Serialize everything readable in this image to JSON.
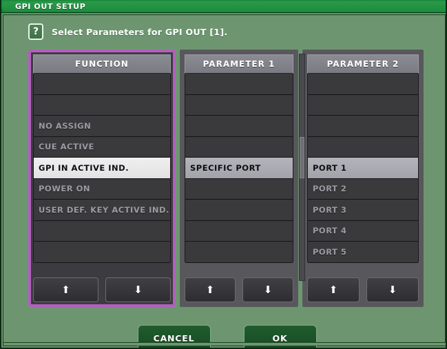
{
  "window": {
    "title": "GPI OUT SETUP"
  },
  "help": {
    "icon": "question-mark-icon",
    "glyph": "?",
    "message": "Select Parameters for GPI OUT [1]."
  },
  "columns": [
    {
      "id": "function",
      "header": "FUNCTION",
      "focused": true,
      "rows": [
        {
          "label": "",
          "state": "empty"
        },
        {
          "label": "",
          "state": "empty"
        },
        {
          "label": "NO ASSIGN",
          "state": "normal"
        },
        {
          "label": "CUE ACTIVE",
          "state": "normal"
        },
        {
          "label": "GPI IN ACTIVE IND.",
          "state": "selected-bright"
        },
        {
          "label": "POWER ON",
          "state": "normal"
        },
        {
          "label": "USER DEF. KEY ACTIVE IND.",
          "state": "normal"
        },
        {
          "label": "",
          "state": "empty"
        },
        {
          "label": "",
          "state": "empty"
        }
      ],
      "scroll_up": {
        "icon": "arrow-up-icon",
        "glyph": "⬆"
      },
      "scroll_down": {
        "icon": "arrow-down-icon",
        "glyph": "⬇"
      }
    },
    {
      "id": "parameter-1",
      "header": "PARAMETER 1",
      "focused": false,
      "rows": [
        {
          "label": "",
          "state": "empty"
        },
        {
          "label": "",
          "state": "empty"
        },
        {
          "label": "",
          "state": "empty"
        },
        {
          "label": "",
          "state": "empty"
        },
        {
          "label": "SPECIFIC PORT",
          "state": "selected-mid"
        },
        {
          "label": "",
          "state": "empty"
        },
        {
          "label": "",
          "state": "empty"
        },
        {
          "label": "",
          "state": "empty"
        },
        {
          "label": "",
          "state": "empty"
        }
      ],
      "scroll_up": {
        "icon": "arrow-up-icon",
        "glyph": "⬆"
      },
      "scroll_down": {
        "icon": "arrow-down-icon",
        "glyph": "⬇"
      }
    },
    {
      "id": "parameter-2",
      "header": "PARAMETER 2",
      "focused": false,
      "rows": [
        {
          "label": "",
          "state": "empty"
        },
        {
          "label": "",
          "state": "empty"
        },
        {
          "label": "",
          "state": "empty"
        },
        {
          "label": "",
          "state": "empty"
        },
        {
          "label": "PORT 1",
          "state": "selected-mid"
        },
        {
          "label": "PORT 2",
          "state": "normal"
        },
        {
          "label": "PORT 3",
          "state": "normal"
        },
        {
          "label": "PORT 4",
          "state": "normal"
        },
        {
          "label": "PORT 5",
          "state": "normal"
        }
      ],
      "scroll_up": {
        "icon": "arrow-up-icon",
        "glyph": "⬆"
      },
      "scroll_down": {
        "icon": "arrow-down-icon",
        "glyph": "⬇"
      }
    }
  ],
  "actions": {
    "cancel_label": "CANCEL",
    "ok_label": "OK"
  },
  "colors": {
    "background": "#6d9670",
    "titlebar": "#17a043",
    "focus_border": "#b35fbf",
    "panel": "#58585c",
    "list_row": "#3a3a3d",
    "selected_bright": "#e8e8e8",
    "selected_mid": "#a8a8b0",
    "button_green": "#1b5227"
  }
}
